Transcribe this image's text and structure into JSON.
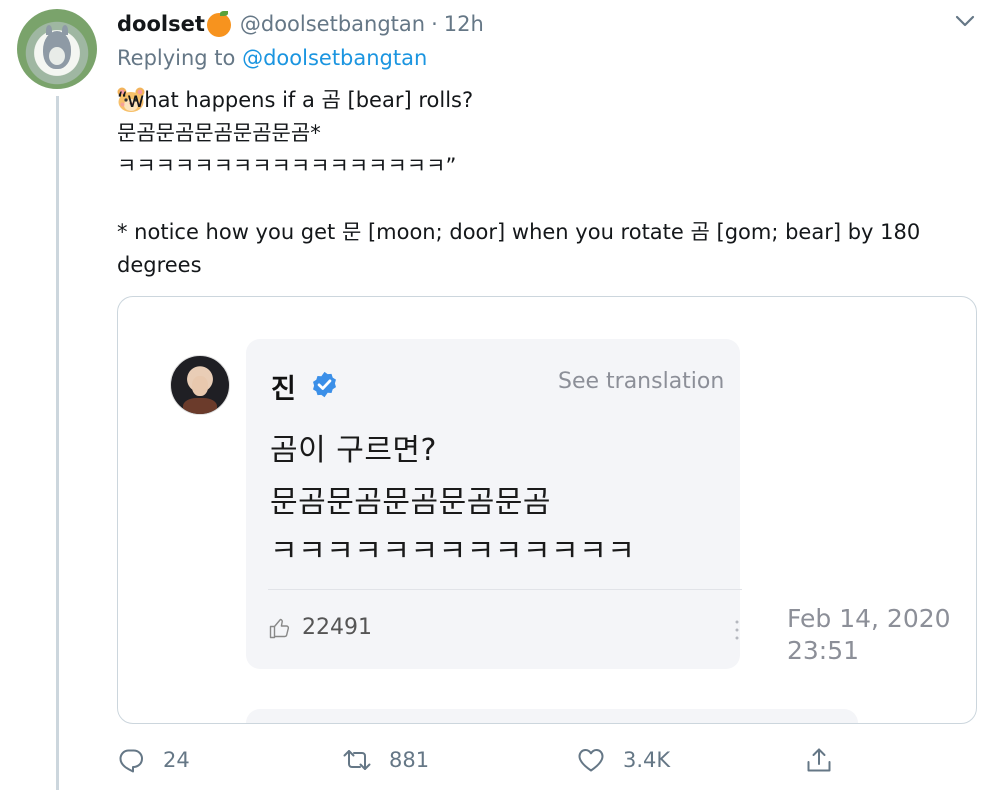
{
  "tweet": {
    "display_name": "doolset",
    "handle": "@doolsetbangtan",
    "dot": "·",
    "time": "12h",
    "replying_prefix": "Replying to",
    "replying_to": "@doolsetbangtan",
    "body": "    “what happens if a 곰 [bear] rolls?\n문곰문곰문곰문곰문곰*\nㅋㅋㅋㅋㅋㅋㅋㅋㅋㅋㅋㅋㅋㅋㅋㅋㅋ”\n\n* notice how you get 문 [moon; door] when you rotate 곰 [gom; bear] by 180 degrees",
    "icons": {
      "avatar": "totoro-avatar",
      "name_emoji": "tangerine-icon",
      "body_emoji": "hamster-face-icon",
      "menu": "chevron-down-icon"
    }
  },
  "embedded": {
    "name": "진",
    "see_translation": "See translation",
    "lines": [
      "곰이 구르면?",
      "문곰문곰문곰문곰문곰",
      "ㅋㅋㅋㅋㅋㅋㅋㅋㅋㅋㅋㅋㅋ"
    ],
    "likes": "22491",
    "date": "Feb 14, 2020\n23:51",
    "verified_color": "#3b8fe8"
  },
  "actions": {
    "replies": "24",
    "retweets": "881",
    "likes": "3.4K",
    "icons": [
      "reply-icon",
      "retweet-icon",
      "like-icon",
      "share-icon"
    ]
  },
  "colors": {
    "accent": "#1b95e0",
    "muted": "#657786",
    "border": "#ccd6dd"
  }
}
